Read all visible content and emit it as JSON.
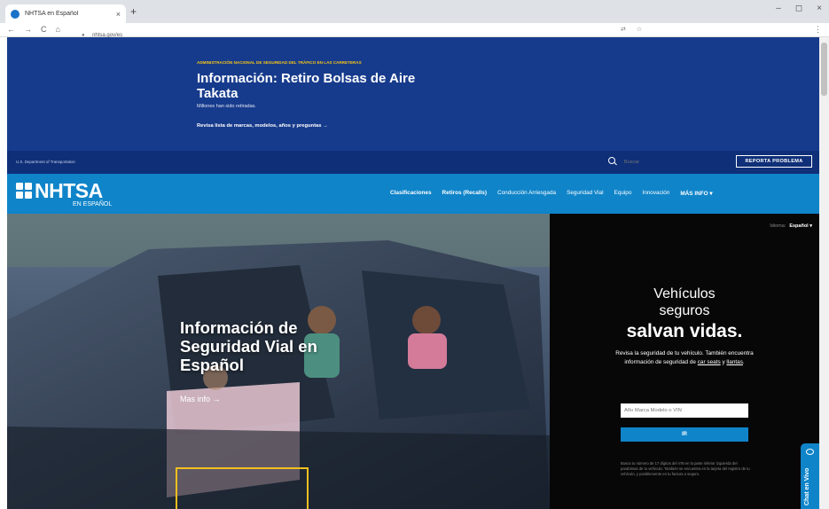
{
  "browser": {
    "tab_title": "NHTSA en Español",
    "tab_close": "×",
    "new_tab": "+",
    "url": "nhtsa.gov/es",
    "window_controls": [
      "–",
      "◻",
      "×"
    ],
    "nav_buttons": [
      "←",
      "→",
      "C",
      "⌂"
    ]
  },
  "alert": {
    "eyebrow": "ADMINISTRACIÓN NACIONAL DE SEGURIDAD DEL TRÁFICO EN LAS CARRETERAS",
    "title": "Información: Retiro Bolsas de Aire Takata",
    "subtitle": "Millones han sido retiradas.",
    "cta": "Revisa lista de marcas, modelos, años y preguntas →"
  },
  "utility": {
    "department": "U.S. Department of Transportation",
    "search_placeholder": "Buscar",
    "report_button": "REPORTA PROBLEMA"
  },
  "nav": {
    "logo_word": "NHTSA",
    "logo_tag": "EN ESPAÑOL",
    "links": [
      {
        "label": "Clasificaciones",
        "bold": true
      },
      {
        "label": "Retiros (Recalls)",
        "bold": true
      },
      {
        "label": "Conducción Arriesgada",
        "bold": false
      },
      {
        "label": "Seguridad Vial",
        "bold": false
      },
      {
        "label": "Equipo",
        "bold": false
      },
      {
        "label": "Innovación",
        "bold": false
      },
      {
        "label": "MÁS INFO ▾",
        "bold": true
      }
    ]
  },
  "hero": {
    "title": "Información de Seguridad Vial en Español",
    "more_link": "Mas info →"
  },
  "panel": {
    "language_label": "Idioma:",
    "language_value": "Español ▾",
    "headline_1": "Vehículos",
    "headline_2": "seguros",
    "headline_3": "salvan vidas.",
    "description_1": "Revisa la seguridad de tu vehículo. También encuentra información de seguridad de ",
    "description_link_1": "car seats",
    "description_2": " y ",
    "description_link_2": "llantas",
    "description_3": ".",
    "vin_placeholder": "Año Marca Modelo o VIN",
    "go_button": "IR",
    "fine_print": "Busca tu número de 17 dígitos del VIN en la parte inferior izquierda del parabrisas de tu vehículo. También se encuentra en la tarjeta del registro de tu vehículo, y posiblemente en tu factura o seguro."
  },
  "chat": {
    "label": "Chat en Vivo"
  },
  "colors": {
    "alert_bg": "#173b8c",
    "nav_bg": "#0f84c9",
    "accent_yellow": "#f2c01c"
  }
}
